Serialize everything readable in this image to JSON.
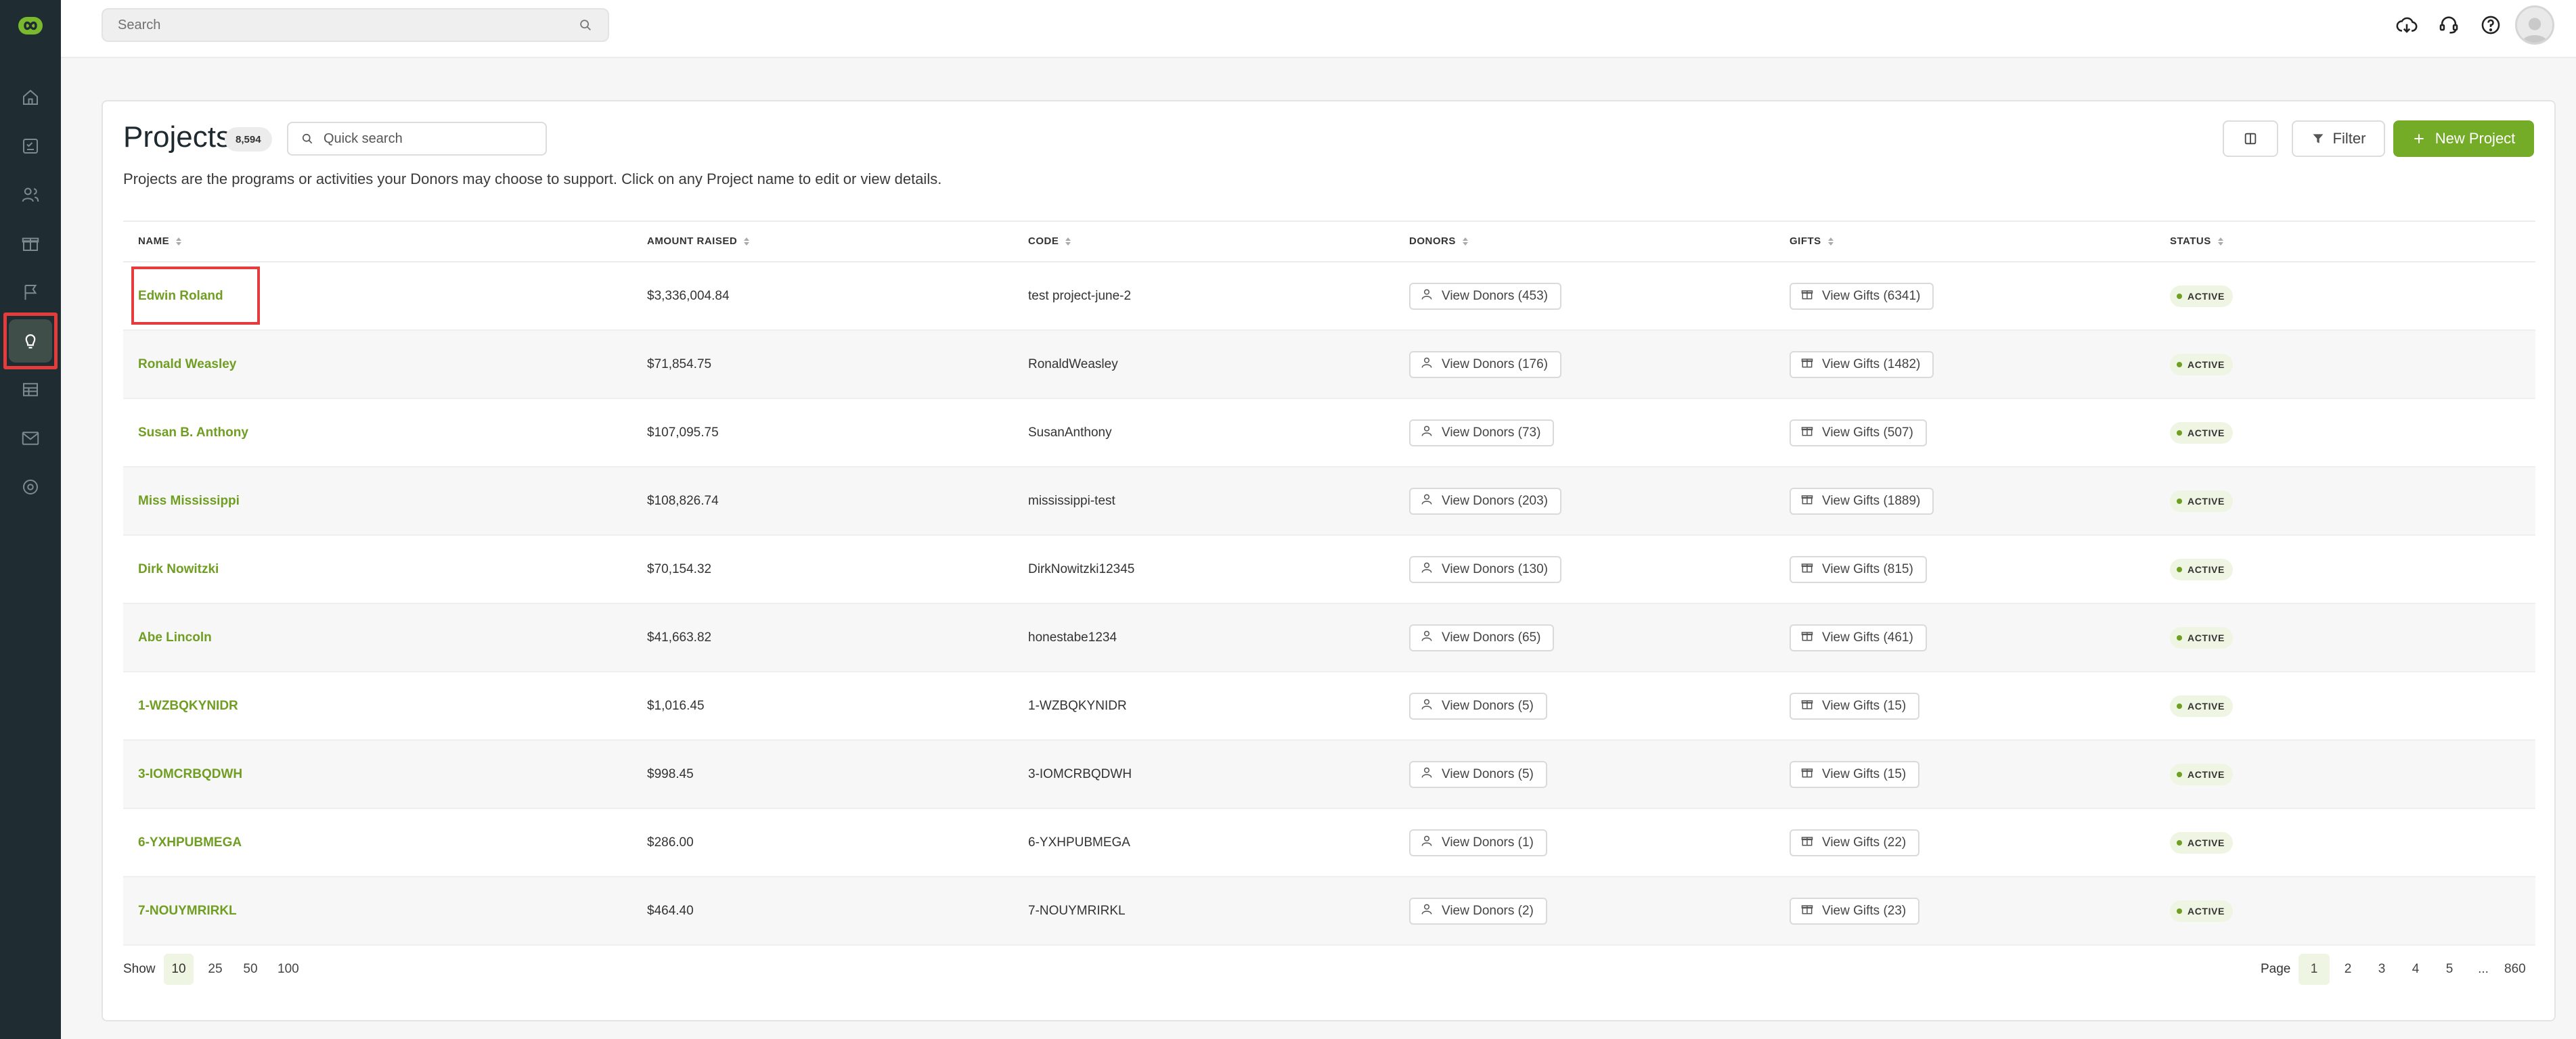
{
  "topbar": {
    "search_placeholder": "Search"
  },
  "page": {
    "title": "Projects",
    "count": "8,594",
    "quick_search_placeholder": "Quick search",
    "description": "Projects are the programs or activities your Donors may choose to support. Click on any Project name to edit or view details.",
    "filter_label": "Filter",
    "new_label": "New Project",
    "accent_color": "#74ab27"
  },
  "table": {
    "headers": [
      "NAME",
      "AMOUNT RAISED",
      "CODE",
      "DONORS",
      "GIFTS",
      "STATUS"
    ],
    "rows": [
      {
        "name": "Edwin Roland",
        "amount": "$3,336,004.84",
        "code": "test project-june-2",
        "donors": "View Donors (453)",
        "gifts": "View Gifts (6341)",
        "status": "ACTIVE"
      },
      {
        "name": "Ronald Weasley",
        "amount": "$71,854.75",
        "code": "RonaldWeasley",
        "donors": "View Donors (176)",
        "gifts": "View Gifts (1482)",
        "status": "ACTIVE"
      },
      {
        "name": "Susan B. Anthony",
        "amount": "$107,095.75",
        "code": "SusanAnthony",
        "donors": "View Donors (73)",
        "gifts": "View Gifts (507)",
        "status": "ACTIVE"
      },
      {
        "name": "Miss Mississippi",
        "amount": "$108,826.74",
        "code": "mississippi-test",
        "donors": "View Donors (203)",
        "gifts": "View Gifts (1889)",
        "status": "ACTIVE"
      },
      {
        "name": "Dirk Nowitzki",
        "amount": "$70,154.32",
        "code": "DirkNowitzki12345",
        "donors": "View Donors (130)",
        "gifts": "View Gifts (815)",
        "status": "ACTIVE"
      },
      {
        "name": "Abe Lincoln",
        "amount": "$41,663.82",
        "code": "honestabe1234",
        "donors": "View Donors (65)",
        "gifts": "View Gifts (461)",
        "status": "ACTIVE"
      },
      {
        "name": "1-WZBQKYNIDR",
        "amount": "$1,016.45",
        "code": "1-WZBQKYNIDR",
        "donors": "View Donors (5)",
        "gifts": "View Gifts (15)",
        "status": "ACTIVE"
      },
      {
        "name": "3-IOMCRBQDWH",
        "amount": "$998.45",
        "code": "3-IOMCRBQDWH",
        "donors": "View Donors (5)",
        "gifts": "View Gifts (15)",
        "status": "ACTIVE"
      },
      {
        "name": "6-YXHPUBMEGA",
        "amount": "$286.00",
        "code": "6-YXHPUBMEGA",
        "donors": "View Donors (1)",
        "gifts": "View Gifts (22)",
        "status": "ACTIVE"
      },
      {
        "name": "7-NOUYMRIRKL",
        "amount": "$464.40",
        "code": "7-NOUYMRIRKL",
        "donors": "View Donors (2)",
        "gifts": "View Gifts (23)",
        "status": "ACTIVE"
      }
    ]
  },
  "footer": {
    "show_label": "Show",
    "page_sizes": [
      "10",
      "25",
      "50",
      "100"
    ],
    "selected_page_size": "10",
    "page_label": "Page",
    "pages": [
      "1",
      "2",
      "3",
      "4",
      "5",
      "...",
      "860"
    ],
    "current_page": "1"
  },
  "sidebar": {
    "items": [
      {
        "icon": "home-icon"
      },
      {
        "icon": "checklist-icon"
      },
      {
        "icon": "users-icon"
      },
      {
        "icon": "gift-icon"
      },
      {
        "icon": "flag-icon"
      },
      {
        "icon": "lightbulb-icon",
        "active": true
      },
      {
        "icon": "table-icon"
      },
      {
        "icon": "mail-check-icon"
      },
      {
        "icon": "settings-icon"
      }
    ]
  }
}
